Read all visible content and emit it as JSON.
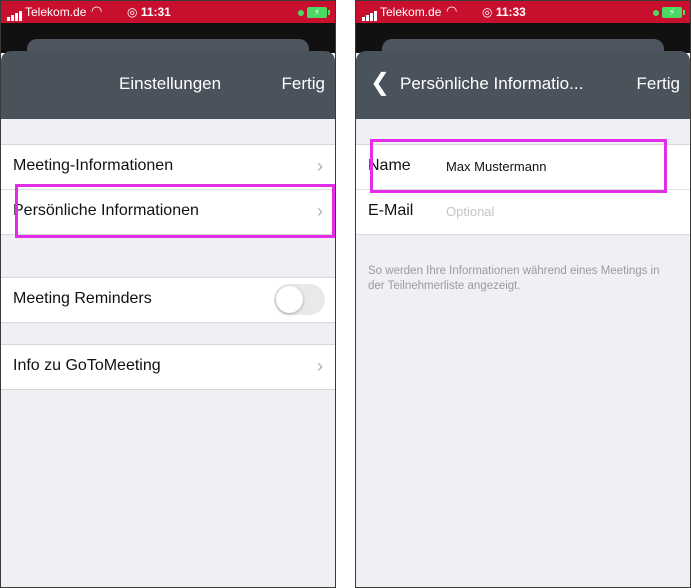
{
  "left_screen": {
    "status_bar": {
      "carrier": "Telekom.de",
      "time": "11:31"
    },
    "nav": {
      "title": "Einstellungen",
      "done_label": "Fertig"
    },
    "group1": {
      "meeting_info_label": "Meeting-Informationen",
      "personal_info_label": "Persönliche Informationen"
    },
    "reminders": {
      "label": "Meeting Reminders",
      "enabled": false
    },
    "about": {
      "label": "Info zu GoToMeeting"
    }
  },
  "right_screen": {
    "status_bar": {
      "carrier": "Telekom.de",
      "time": "11:33"
    },
    "nav": {
      "title": "Persönliche Informatio...",
      "done_label": "Fertig"
    },
    "form": {
      "name_label": "Name",
      "name_value": "Max Mustermann",
      "email_label": "E-Mail",
      "email_placeholder": "Optional"
    },
    "footnote": "So werden Ihre Informationen während eines Meetings in der Teilnehmerliste angezeigt."
  },
  "icons": [
    "signal-icon",
    "wifi-icon",
    "alarm-icon",
    "battery-icon",
    "chevron-right-icon",
    "back-chevron-icon",
    "toggle-switch"
  ],
  "colors": {
    "status_bar": "#c8102e",
    "nav_bar": "#4a525c",
    "highlight": "#e22ee6",
    "background": "#efeff4"
  }
}
